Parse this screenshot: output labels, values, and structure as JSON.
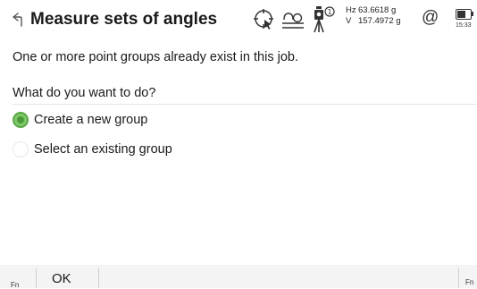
{
  "header": {
    "title": "Measure sets of angles",
    "back_icon": "back-arrow-icon",
    "angles": {
      "hz_label": "Hz",
      "hz_value": "63.6618 g",
      "v_label": "V",
      "v_value": "157.4972 g"
    },
    "at_symbol": "@",
    "battery_level": 0.7,
    "time": "15:33"
  },
  "main": {
    "info_text": "One or more point groups already exist in this job.",
    "question": "What do you want to do?",
    "options": [
      {
        "label": "Create a new group",
        "selected": true
      },
      {
        "label": "Select an existing group",
        "selected": false
      }
    ]
  },
  "footer": {
    "fn_left": "Fn",
    "ok_label": "OK",
    "fn_right": "Fn"
  },
  "colors": {
    "radio_selected": "#7dc66a",
    "radio_selected_dot": "#4a9b38",
    "bottom_bar": "#f4f4f4"
  }
}
